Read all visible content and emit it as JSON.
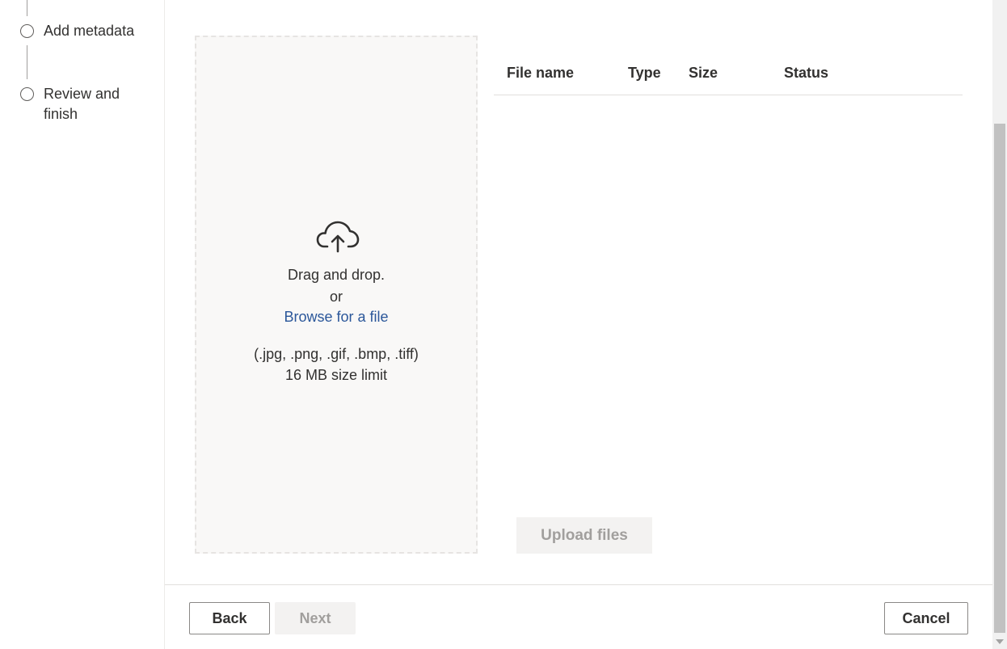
{
  "stepper": {
    "steps": [
      {
        "label_line1": "Add metadata",
        "label_line2": ""
      },
      {
        "label_line1": "Review and",
        "label_line2": "finish"
      }
    ]
  },
  "dropzone": {
    "icon": "cloud-upload-icon",
    "drag_text": "Drag and drop.",
    "or_text": "or",
    "browse_link": "Browse for a file",
    "formats": "(.jpg, .png, .gif, .bmp, .tiff)",
    "size_limit": "16 MB size limit"
  },
  "file_table": {
    "columns": [
      "File name",
      "Type",
      "Size",
      "Status"
    ],
    "rows": []
  },
  "upload_button": "Upload files",
  "footer": {
    "back": "Back",
    "next": "Next",
    "cancel": "Cancel"
  },
  "colors": {
    "link": "#2b579a",
    "disabled_bg": "#f3f2f1",
    "disabled_text": "#a19f9d",
    "dropzone_bg": "#f9f8f7"
  }
}
